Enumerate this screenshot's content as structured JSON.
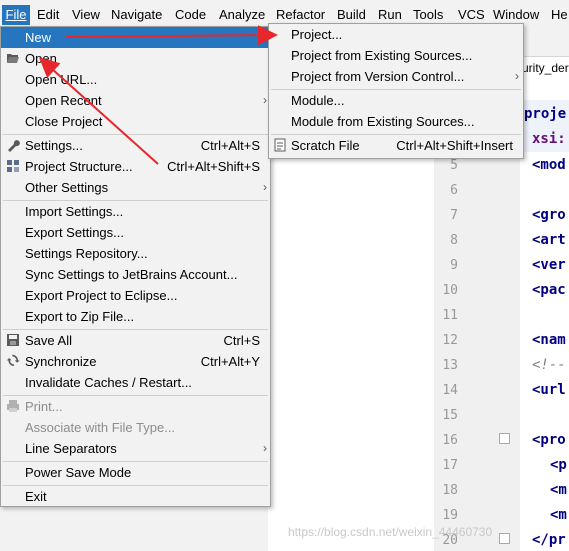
{
  "menubar": {
    "items": [
      {
        "key": "file",
        "label": "File"
      },
      {
        "key": "edit",
        "label": "Edit"
      },
      {
        "key": "view",
        "label": "View"
      },
      {
        "key": "navigate",
        "label": "Navigate"
      },
      {
        "key": "code",
        "label": "Code"
      },
      {
        "key": "analyze",
        "label": "Analyze"
      },
      {
        "key": "refactor",
        "label": "Refactor"
      },
      {
        "key": "build",
        "label": "Build"
      },
      {
        "key": "run",
        "label": "Run"
      },
      {
        "key": "tools",
        "label": "Tools"
      },
      {
        "key": "vcs",
        "label": "VCS"
      },
      {
        "key": "window",
        "label": "Window"
      },
      {
        "key": "help",
        "label": "He"
      }
    ]
  },
  "file_menu": {
    "new": "New",
    "open": "Open",
    "open_url": "Open URL...",
    "open_recent": "Open Recent",
    "close_project": "Close Project",
    "settings": "Settings...",
    "settings_sc": "Ctrl+Alt+S",
    "project_structure": "Project Structure...",
    "project_structure_sc": "Ctrl+Alt+Shift+S",
    "other_settings": "Other Settings",
    "import_settings": "Import Settings...",
    "export_settings": "Export Settings...",
    "settings_repository": "Settings Repository...",
    "sync_settings": "Sync Settings to JetBrains Account...",
    "export_eclipse": "Export Project to Eclipse...",
    "export_zip": "Export to Zip File...",
    "save_all": "Save All",
    "save_all_sc": "Ctrl+S",
    "synchronize": "Synchronize",
    "synchronize_sc": "Ctrl+Alt+Y",
    "invalidate": "Invalidate Caches / Restart...",
    "print": "Print...",
    "associate": "Associate with File Type...",
    "line_separators": "Line Separators",
    "power_save": "Power Save Mode",
    "exit": "Exit"
  },
  "new_menu": {
    "project": "Project...",
    "project_existing": "Project from Existing Sources...",
    "project_vcs": "Project from Version Control...",
    "module": "Module...",
    "module_existing": "Module from Existing Sources...",
    "scratch_file": "Scratch File",
    "scratch_file_sc": "Ctrl+Alt+Shift+Insert"
  },
  "editor": {
    "tab_label": "urity_der",
    "line_numbers": [
      "5",
      "6",
      "7",
      "8",
      "9",
      "10",
      "11",
      "12",
      "13",
      "14",
      "15",
      "16",
      "17",
      "18",
      "19",
      "20"
    ],
    "code_lines": [
      "proje",
      "xsi:",
      "<mod",
      "<gro",
      "<art",
      "<ver",
      "<pac",
      "<nam",
      "<!--",
      "<url",
      "<pro",
      "<p",
      "<m",
      "<m",
      "</pr"
    ]
  },
  "watermark": "https://blog.csdn.net/weixin_44460730",
  "colors": {
    "selection": "#2675bf",
    "arrow": "#e8262b",
    "menu_bg": "#f2f2f2"
  }
}
